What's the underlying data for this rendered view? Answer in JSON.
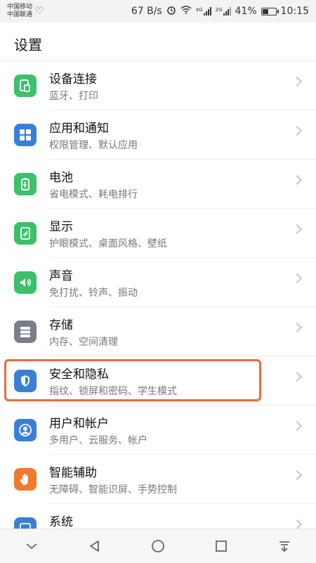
{
  "status_bar": {
    "carrier_1": "中国移动",
    "carrier_2": "中国联通",
    "net_speed": "67 B/s",
    "net_4g": "4G",
    "net_2g": "2G",
    "battery_pct": "41%",
    "time": "10:15"
  },
  "header": {
    "title": "设置"
  },
  "settings": [
    {
      "name": "device-connection",
      "title": "设备连接",
      "subtitle": "蓝牙、打印",
      "color": "#3cc06a",
      "icon": "device-link-icon"
    },
    {
      "name": "apps-notifications",
      "title": "应用和通知",
      "subtitle": "权限管理、默认应用",
      "color": "#3a7fd6",
      "icon": "apps-grid-icon"
    },
    {
      "name": "battery",
      "title": "电池",
      "subtitle": "省电模式、耗电排行",
      "color": "#3cc06a",
      "icon": "battery-icon"
    },
    {
      "name": "display",
      "title": "显示",
      "subtitle": "护眼模式、桌面风格、壁纸",
      "color": "#3cc06a",
      "icon": "display-icon"
    },
    {
      "name": "sound",
      "title": "声音",
      "subtitle": "免打扰、铃声、振动",
      "color": "#3cc06a",
      "icon": "speaker-icon"
    },
    {
      "name": "storage",
      "title": "存储",
      "subtitle": "内存、空间清理",
      "color": "#7a7f87",
      "icon": "storage-icon"
    },
    {
      "name": "security-privacy",
      "title": "安全和隐私",
      "subtitle": "指纹、锁屏和密码、学生模式",
      "color": "#3a7fd6",
      "icon": "shield-icon"
    },
    {
      "name": "users-accounts",
      "title": "用户和帐户",
      "subtitle": "多用户、云服务、帐户",
      "color": "#3a7fd6",
      "icon": "user-icon"
    },
    {
      "name": "smart-assist",
      "title": "智能辅助",
      "subtitle": "无障碍、智能识屏、手势控制",
      "color": "#f07a2b",
      "icon": "hand-icon"
    },
    {
      "name": "system",
      "title": "系统",
      "subtitle": "",
      "color": "#3a7fd6",
      "icon": "system-icon"
    }
  ],
  "highlight_color": "#ef6a3a"
}
